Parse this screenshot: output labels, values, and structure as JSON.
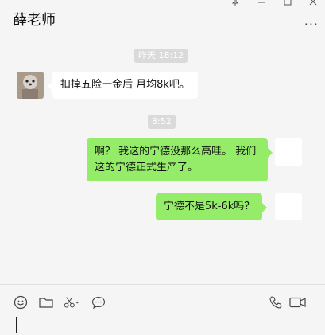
{
  "header": {
    "title": "薛老师",
    "more_label": "···"
  },
  "messages": [
    {
      "type": "time",
      "text": "昨天 18:12"
    },
    {
      "type": "incoming",
      "text": "扣掉五险一金后 月均8k吧。"
    },
    {
      "type": "time",
      "text": "8:52"
    },
    {
      "type": "outgoing",
      "text": "啊？ 我这的宁德没那么高哇。 我们这的宁德正式生产了。"
    },
    {
      "type": "outgoing",
      "text": "宁德不是5k-6k吗？"
    }
  ],
  "icons": {
    "pin": "pin-icon",
    "minimize": "minimize-icon",
    "maximize": "maximize-icon",
    "more": "more-icon",
    "emoji": "emoji-icon",
    "folder": "folder-icon",
    "scissors": "scissors-icon",
    "chat": "chat-bubble-icon",
    "phone": "phone-icon",
    "video": "video-icon"
  },
  "colors": {
    "outgoing_bubble": "#95ec69",
    "incoming_bubble": "#ffffff",
    "background": "#f5f5f5"
  }
}
